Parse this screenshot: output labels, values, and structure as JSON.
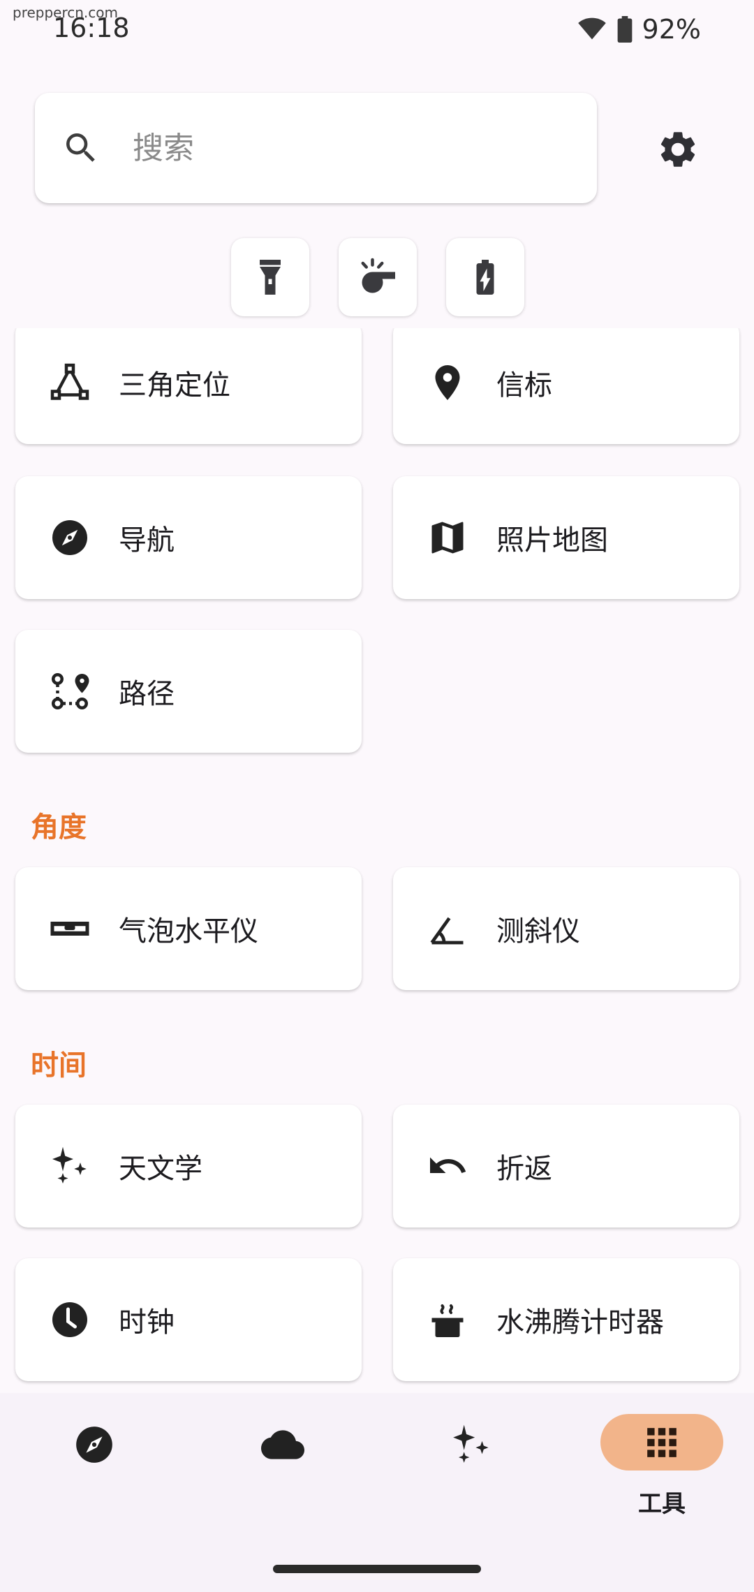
{
  "status_bar": {
    "watermark": "preppercn.com",
    "time": "16:18",
    "battery": "92%"
  },
  "search": {
    "placeholder": "搜索"
  },
  "quick_actions": [
    "flashlight-icon",
    "whistle-icon",
    "battery-icon"
  ],
  "tools": {
    "triangulate": "三角定位",
    "beacons": "信标",
    "navigation": "导航",
    "photo_maps": "照片地图",
    "paths": "路径",
    "section_angles": "角度",
    "bubble_level": "气泡水平仪",
    "clinometer": "测斜仪",
    "section_time": "时间",
    "astronomy": "天文学",
    "backtrack": "折返",
    "clock": "时钟",
    "water_boil_timer": "水沸腾计时器"
  },
  "bottom_nav": {
    "tools_label": "工具",
    "items": [
      "navigation-icon",
      "weather-icon",
      "astronomy-icon",
      "tools-icon"
    ]
  },
  "colors": {
    "accent": "#e8742a",
    "active_pill": "#f2b48a"
  }
}
